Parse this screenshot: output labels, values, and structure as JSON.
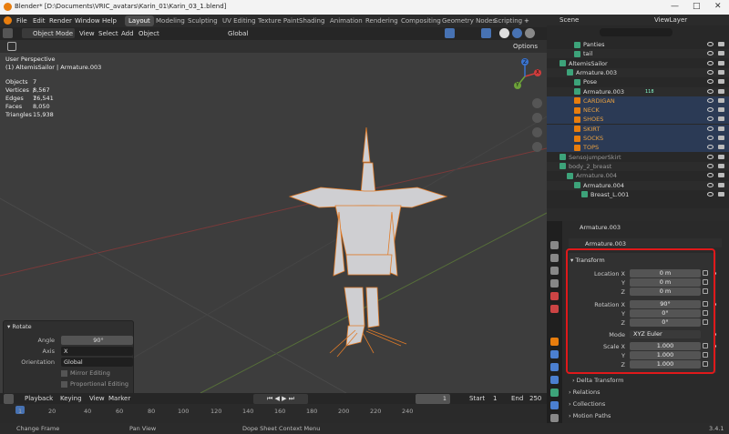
{
  "window": {
    "title": "Blender* [D:\\Documents\\VRIC_avatars\\Karin_01\\Karin_03_1.blend]"
  },
  "menus": [
    "File",
    "Edit",
    "Render",
    "Window",
    "Help"
  ],
  "workspaces": [
    "Layout",
    "Modeling",
    "Sculpting",
    "UV Editing",
    "Texture Paint",
    "Shading",
    "Animation",
    "Rendering",
    "Compositing",
    "Geometry Nodes",
    "Scripting"
  ],
  "scene": {
    "label": "Scene",
    "viewlayer": "ViewLayer"
  },
  "viewport": {
    "mode": "Object Mode",
    "menus": [
      "View",
      "Select",
      "Add",
      "Object"
    ],
    "orientation": "Global",
    "options": "Options",
    "perspective": "User Perspective",
    "context": "(1) AltemisSailor | Armature.003",
    "stats": [
      {
        "label": "Objects",
        "value": "7 / 7"
      },
      {
        "label": "Vertices",
        "value": "8,567"
      },
      {
        "label": "Edges",
        "value": "16,541"
      },
      {
        "label": "Faces",
        "value": "8,050"
      },
      {
        "label": "Triangles",
        "value": "15,938"
      }
    ],
    "gizmo": {
      "x": "X",
      "y": "Y",
      "z": "Z"
    }
  },
  "rotate_panel": {
    "title": "Rotate",
    "angle_label": "Angle",
    "angle_value": "90°",
    "axis_label": "Axis",
    "axis_value": "X",
    "orientation_label": "Orientation",
    "orientation_value": "Global",
    "mirror": "Mirror Editing",
    "proportional": "Proportional Editing"
  },
  "outliner": [
    {
      "name": "Panties",
      "indent": 3
    },
    {
      "name": "tail",
      "indent": 3
    },
    {
      "name": "AltemisSailor",
      "indent": 1
    },
    {
      "name": "Armature.003",
      "indent": 2,
      "selected": true
    },
    {
      "name": "Pose",
      "indent": 3
    },
    {
      "name": "Armature.003",
      "indent": 3,
      "badge": "118"
    },
    {
      "name": "CARDIGAN",
      "indent": 3,
      "orange": true,
      "sel": true
    },
    {
      "name": "NECK",
      "indent": 3,
      "orange": true,
      "sel": true
    },
    {
      "name": "SHOES",
      "indent": 3,
      "orange": true,
      "sel": true
    },
    {
      "name": "SKIRT",
      "indent": 3,
      "orange": true,
      "sel": true
    },
    {
      "name": "SOCKS",
      "indent": 3,
      "orange": true,
      "sel": true
    },
    {
      "name": "TOPS",
      "indent": 3,
      "orange": true,
      "sel": true
    },
    {
      "name": "SensojumperSkirt",
      "indent": 1,
      "dim": true
    },
    {
      "name": "body_2_breast",
      "indent": 1,
      "dim": true
    },
    {
      "name": "Armature.004",
      "indent": 2,
      "dim": true
    },
    {
      "name": "Armature.004",
      "indent": 3
    },
    {
      "name": "Breast_L.001",
      "indent": 4
    }
  ],
  "properties": {
    "object": "Armature.003",
    "object_data": "Armature.003",
    "transform_title": "Transform",
    "location": {
      "label": "Location X",
      "x": "0 m",
      "y": "0 m",
      "z": "0 m"
    },
    "rotation": {
      "label": "Rotation X",
      "x": "90°",
      "y": "0°",
      "z": "0°"
    },
    "mode": {
      "label": "Mode",
      "value": "XYZ Euler"
    },
    "scale": {
      "label": "Scale X",
      "x": "1.000",
      "y": "1.000",
      "z": "1.000"
    },
    "y_label": "Y",
    "z_label": "Z",
    "sections": [
      "Delta Transform",
      "Relations",
      "Collections",
      "Motion Paths"
    ]
  },
  "timeline": {
    "menus": [
      "Playback",
      "Keying",
      "View",
      "Marker"
    ],
    "current_frame": "1",
    "start_label": "Start",
    "start": "1",
    "end_label": "End",
    "end": "250",
    "ticks": [
      "1",
      "20",
      "40",
      "60",
      "80",
      "100",
      "120",
      "140",
      "160",
      "180",
      "200",
      "220",
      "240"
    ]
  },
  "status": {
    "left": "Change Frame",
    "mid": "Pan View",
    "right": "Dope Sheet Context Menu",
    "version": "3.4.1"
  },
  "colors": {
    "accent": "#e87d0d",
    "selection": "#334d80",
    "highlight_box": "#e0191b"
  }
}
